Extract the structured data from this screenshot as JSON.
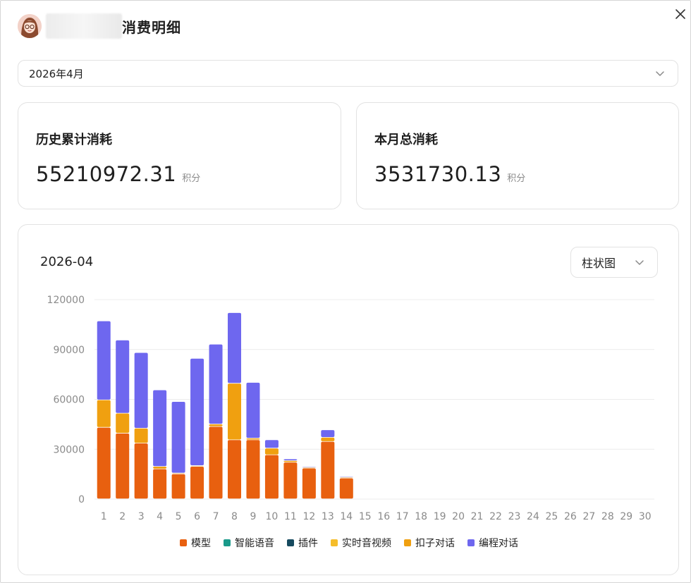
{
  "header": {
    "title": "消费明细"
  },
  "month_select": {
    "value": "2026年4月"
  },
  "cards": [
    {
      "label": "历史累计消耗",
      "value": "55210972.31",
      "unit": "积分"
    },
    {
      "label": "本月总消耗",
      "value": "3531730.13",
      "unit": "积分"
    }
  ],
  "chart_section": {
    "title": "2026-04",
    "type_select": "柱状图"
  },
  "colors": {
    "模型": "#e8600f",
    "智能语音": "#1a9a8a",
    "插件": "#164a5f",
    "实时音视频": "#f5bd2a",
    "扣子对话": "#f0a010",
    "编程对话": "#6e67ef"
  },
  "chart_data": {
    "type": "bar",
    "stacked": true,
    "categories": [
      "1",
      "2",
      "3",
      "4",
      "5",
      "6",
      "7",
      "8",
      "9",
      "10",
      "11",
      "12",
      "13",
      "14",
      "15",
      "16",
      "17",
      "18",
      "19",
      "20",
      "21",
      "22",
      "23",
      "24",
      "25",
      "26",
      "27",
      "28",
      "29",
      "30"
    ],
    "yticks": [
      "120000",
      "90000",
      "60000",
      "30000",
      "0"
    ],
    "ylim": [
      0,
      120000
    ],
    "grid": true,
    "legend_position": "bottom",
    "series": [
      {
        "name": "模型",
        "values": [
          43000,
          39500,
          33500,
          18000,
          15000,
          19500,
          43500,
          35500,
          35500,
          26500,
          22000,
          18500,
          34500,
          12500,
          0,
          0,
          0,
          0,
          0,
          0,
          0,
          0,
          0,
          0,
          0,
          0,
          0,
          0,
          0,
          0
        ]
      },
      {
        "name": "智能语音",
        "values": [
          0,
          0,
          0,
          0,
          0,
          0,
          0,
          0,
          0,
          0,
          0,
          0,
          0,
          0,
          0,
          0,
          0,
          0,
          0,
          0,
          0,
          0,
          0,
          0,
          0,
          0,
          0,
          0,
          0,
          0
        ]
      },
      {
        "name": "插件",
        "values": [
          0,
          0,
          0,
          0,
          0,
          0,
          0,
          0,
          0,
          0,
          0,
          0,
          0,
          0,
          0,
          0,
          0,
          0,
          0,
          0,
          0,
          0,
          0,
          0,
          0,
          0,
          0,
          0,
          0,
          0
        ]
      },
      {
        "name": "实时音视频",
        "values": [
          0,
          0,
          0,
          0,
          0,
          0,
          0,
          0,
          0,
          0,
          0,
          0,
          0,
          0,
          0,
          0,
          0,
          0,
          0,
          0,
          0,
          0,
          0,
          0,
          0,
          0,
          0,
          0,
          0,
          0
        ]
      },
      {
        "name": "扣子对话",
        "values": [
          16500,
          12000,
          9000,
          1500,
          500,
          500,
          1500,
          34000,
          1000,
          4000,
          1000,
          500,
          2500,
          500,
          0,
          0,
          0,
          0,
          0,
          0,
          0,
          0,
          0,
          0,
          0,
          0,
          0,
          0,
          0,
          0
        ]
      },
      {
        "name": "编程对话",
        "values": [
          47500,
          44000,
          45500,
          46000,
          43000,
          64500,
          48000,
          42500,
          33500,
          5000,
          1000,
          500,
          4500,
          500,
          0,
          0,
          0,
          0,
          0,
          0,
          0,
          0,
          0,
          0,
          0,
          0,
          0,
          0,
          0,
          0
        ]
      }
    ]
  }
}
